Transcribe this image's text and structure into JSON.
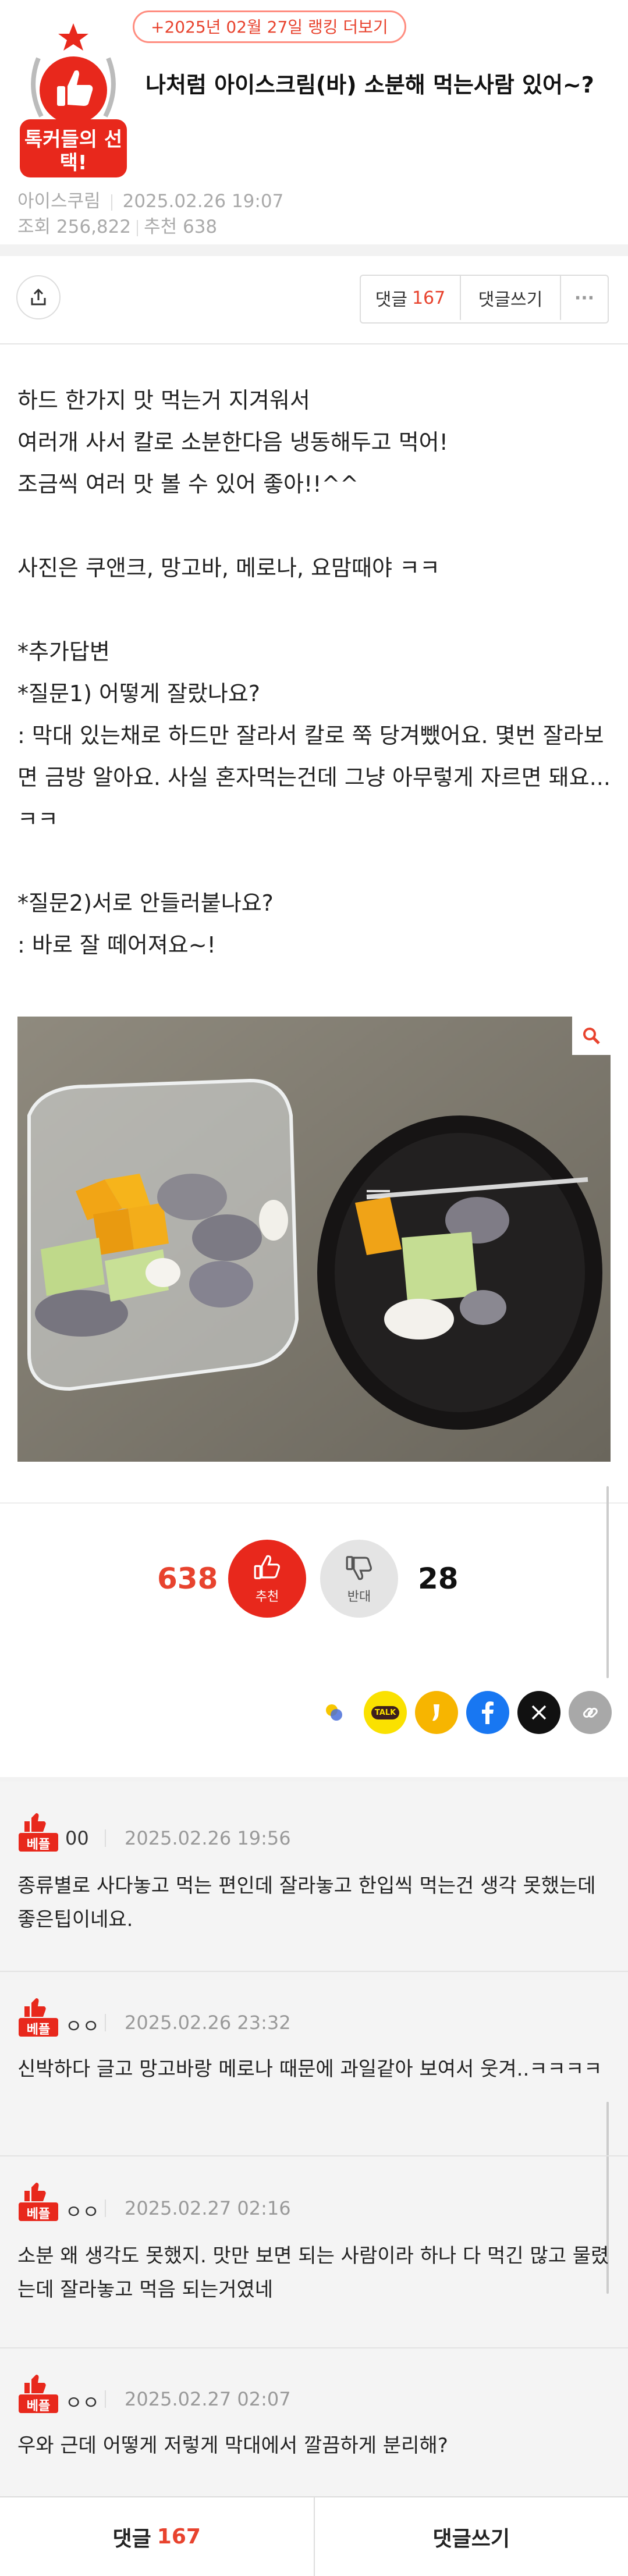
{
  "header": {
    "badge_label": "톡커들의 선택!",
    "rank_link": "+2025년 02월 27일 랭킹 더보기",
    "title": "나처럼 아이스크림(바) 소분해 먹는사람 있어~?",
    "category": "아이스쿠림",
    "date": "2025.02.26 19:07",
    "views": "조회 256,822",
    "recommends": "추천 638"
  },
  "toolbar": {
    "comment_label": "댓글",
    "comment_count": "167",
    "write_comment": "댓글쓰기",
    "more": "···"
  },
  "article": {
    "lines": [
      "하드 한가지 맛 먹는거 지겨워서",
      "여러개 사서 칼로 소분한다음 냉동해두고 먹어!",
      "조금씩 여러 맛 볼 수 있어 좋아!!^^",
      "",
      "사진은 쿠앤크, 망고바, 메로나, 요맘때야 ㅋㅋ",
      "",
      "*추가답변",
      "*질문1) 어떻게 잘랐나요?",
      ": 막대 있는채로 하드만 잘라서 칼로 쭉 당겨뺐어요. 몇번 잘라보면 금방 알아요. 사실 혼자먹는건데 그냥 아무렇게 자르면 돼요... ㅋㅋ",
      "",
      "*질문2)서로 안들러붙나요?",
      ": 바로 잘 떼어져요~!"
    ]
  },
  "votes": {
    "up_count": "638",
    "up_label": "추천",
    "down_label": "반대",
    "down_count": "28"
  },
  "sns": {
    "icons": [
      "kakaostory-icon",
      "kakaotalk-icon",
      "band-icon",
      "facebook-icon",
      "x-icon",
      "link-icon"
    ],
    "talk_label": "TALK"
  },
  "comments": {
    "best_label": "베플",
    "items": [
      {
        "author": "00",
        "date": "2025.02.26 19:56",
        "text": "종류별로 사다놓고 먹는 편인데 잘라놓고 한입씩 먹는건 생각 못했는데 좋은팁이네요."
      },
      {
        "author": "ㅇㅇ",
        "date": "2025.02.26 23:32",
        "text": "신박하다 글고 망고바랑 메로나 때문에 과일같아 보여서 웃겨..ㅋㅋㅋㅋ"
      },
      {
        "author": "ㅇㅇ",
        "date": "2025.02.27 02:16",
        "text": "소분 왜 생각도 못했지. 맛만 보면 되는 사람이라 하나 다 먹긴 많고 물렸는데 잘라놓고 먹음 되는거였네"
      },
      {
        "author": "ㅇㅇ",
        "date": "2025.02.27 02:07",
        "text": "우와 근데 어떻게 저렇게 막대에서 깔끔하게 분리해?"
      }
    ]
  },
  "bottombar": {
    "comment_label": "댓글",
    "comment_count": "167",
    "write_comment": "댓글쓰기"
  },
  "colors": {
    "accent": "#e8432e",
    "vote_up": "#e8281c",
    "kakao": "#fae100",
    "facebook": "#1877f2"
  }
}
